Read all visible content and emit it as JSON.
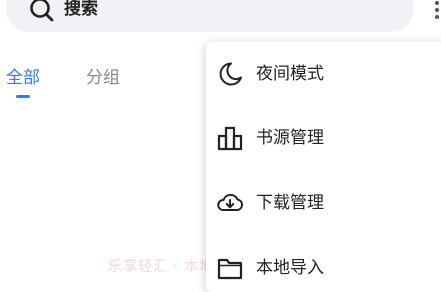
{
  "search": {
    "placeholder": "搜索"
  },
  "tabs": [
    {
      "label": "全部",
      "active": true
    },
    {
      "label": "分组",
      "active": false
    }
  ],
  "watermark": "乐享轻汇 · 本地导入",
  "menu": {
    "items": [
      {
        "label": "夜间模式",
        "icon": "moon-icon"
      },
      {
        "label": "书源管理",
        "icon": "bar-chart-icon"
      },
      {
        "label": "下载管理",
        "icon": "cloud-download-icon"
      },
      {
        "label": "本地导入",
        "icon": "folder-icon"
      }
    ]
  },
  "colors": {
    "accent": "#2f7dea",
    "search_bg": "#f0f2f5",
    "inactive_tab": "#8a8a8a"
  }
}
